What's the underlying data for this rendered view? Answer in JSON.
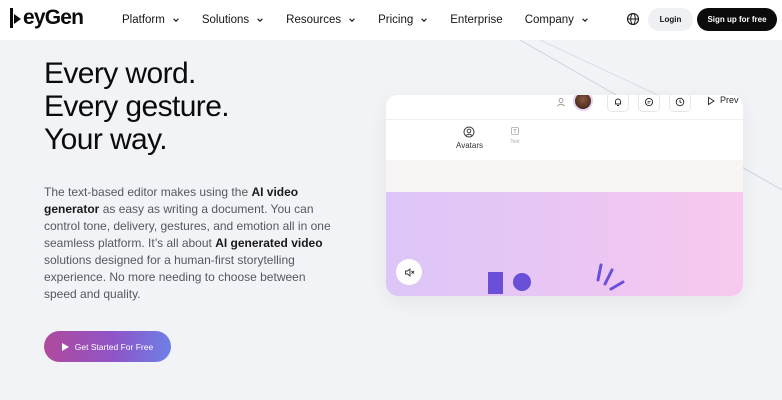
{
  "brand": {
    "logo_text": "eyGen"
  },
  "nav": {
    "items": [
      {
        "label": "Platform",
        "has_dropdown": true
      },
      {
        "label": "Solutions",
        "has_dropdown": true
      },
      {
        "label": "Resources",
        "has_dropdown": true
      },
      {
        "label": "Pricing",
        "has_dropdown": true
      },
      {
        "label": "Enterprise",
        "has_dropdown": false
      },
      {
        "label": "Company",
        "has_dropdown": true
      }
    ],
    "login_label": "Login",
    "signup_label": "Sign up for free",
    "language_icon": "globe-icon"
  },
  "hero": {
    "headline": [
      "Every word.",
      "Every gesture.",
      "Your way."
    ],
    "paragraph": {
      "p1": "The text-based editor makes using the ",
      "b1": "AI video generator",
      "p2": " as easy as writing a document. You can control tone, delivery, gestures, and emotion all in one seamless platform. It’s all about ",
      "b2": "AI generated video",
      "p3": " solutions designed for a human-first storytelling experience. No more needing to choose between speed and quality."
    },
    "cta_label": "Get Started For Free"
  },
  "editor": {
    "preview_label": "Prev",
    "tabs": [
      {
        "label": "Avatars",
        "icon": "avatar-icon"
      },
      {
        "label": "Text",
        "icon": "text-icon"
      }
    ],
    "toolbar_icons": [
      "user-switch-icon",
      "bell-icon",
      "comment-icon",
      "clock-icon",
      "play-icon"
    ],
    "mute_icon": "mute-icon"
  },
  "colors": {
    "cta_gradient_start": "#b04a9c",
    "cta_gradient_end": "#6e7fe6",
    "canvas_shape": "#6a4fd8",
    "signup_bg": "#0b0b0b"
  }
}
